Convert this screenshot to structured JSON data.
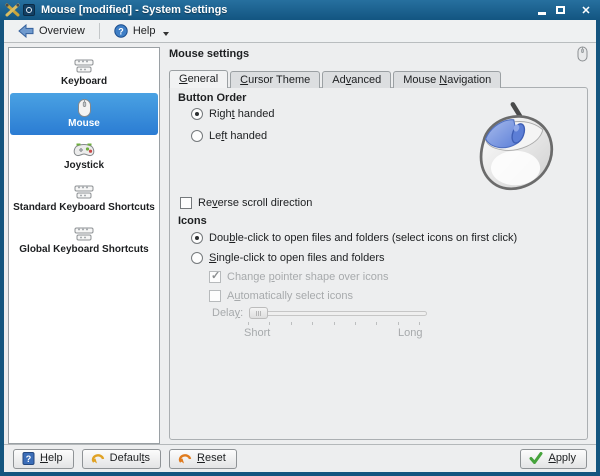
{
  "window": {
    "title": "Mouse [modified] - System Settings",
    "icons": {
      "window_icon": "crossed-tools-icon",
      "badge": "app-badge-icon",
      "minimize": "minimize-icon",
      "maximize": "maximize-icon",
      "close": "close-icon"
    }
  },
  "toolbar": {
    "overview_label": "Overview",
    "help_label": "Help",
    "icons": {
      "overview": "back-arrow-icon",
      "help": "help-circle-icon",
      "help_caret": "chevron-down-icon"
    }
  },
  "sidebar": {
    "items": [
      {
        "label": "Keyboard",
        "icon": "keyboard-icon",
        "selected": false
      },
      {
        "label": "Mouse",
        "icon": "mouse-icon",
        "selected": true
      },
      {
        "label": "Joystick",
        "icon": "joystick-icon",
        "selected": false
      },
      {
        "label": "Standard Keyboard Shortcuts",
        "icon": "keyboard-icon",
        "selected": false
      },
      {
        "label": "Global Keyboard Shortcuts",
        "icon": "keyboard-icon",
        "selected": false
      }
    ]
  },
  "content": {
    "header": "Mouse settings",
    "header_icon": "mouse-small-icon",
    "tabs": [
      {
        "label": {
          "text": "General",
          "u": 0
        },
        "active": true
      },
      {
        "label": {
          "text": "Cursor Theme",
          "u": 0
        },
        "active": false
      },
      {
        "label": {
          "text": "Advanced",
          "u": 2
        },
        "active": false
      },
      {
        "label": {
          "text": "Mouse Navigation",
          "u": 6
        },
        "active": false
      }
    ],
    "button_order": {
      "title": "Button Order",
      "right_handed": {
        "text": "Right handed",
        "u": 4
      },
      "left_handed": {
        "text": "Left handed",
        "u": 2
      },
      "selected": "right_handed"
    },
    "reverse_scroll": {
      "label": {
        "text": "Reverse scroll direction",
        "u": 2
      },
      "checked": false
    },
    "icons_section": {
      "title": "Icons",
      "double_click": {
        "text": "Double-click to open files and folders (select icons on first click)",
        "u": 3
      },
      "single_click": {
        "text": "Single-click to open files and folders",
        "u": 0
      },
      "selected": "double_click",
      "change_pointer": {
        "label": {
          "text": "Change pointer shape over icons",
          "u": 7
        },
        "checked": true,
        "enabled": false
      },
      "auto_select": {
        "label": {
          "text": "Automatically select icons",
          "u": 1
        },
        "checked": false,
        "enabled": false
      },
      "delay": {
        "label": {
          "text": "Delay:",
          "u": 4
        },
        "short_label": "Short",
        "long_label": "Long",
        "value_position": "min",
        "enabled": false
      }
    },
    "illustration": "right-handed-mouse-image"
  },
  "footer": {
    "help": {
      "text": "Help",
      "u": 0
    },
    "defaults": {
      "text": "Defaults",
      "u": 6
    },
    "reset": {
      "text": "Reset",
      "u": 0
    },
    "apply": {
      "text": "Apply",
      "u": 0
    },
    "icons": {
      "help": "help-book-icon",
      "defaults": "defaults-arrow-icon",
      "reset": "reset-arrow-icon",
      "apply": "green-check-icon"
    }
  },
  "colors": {
    "titlebar": "#1b6494",
    "frame": "#14557f",
    "selection_top": "#4aa2e3",
    "selection_bottom": "#2b7cd3",
    "window_bg": "#edeeef",
    "sidebar_bg": "#ffffff",
    "mouse_button_blue": "#6e8cdb",
    "apply_green": "#46a33c"
  }
}
